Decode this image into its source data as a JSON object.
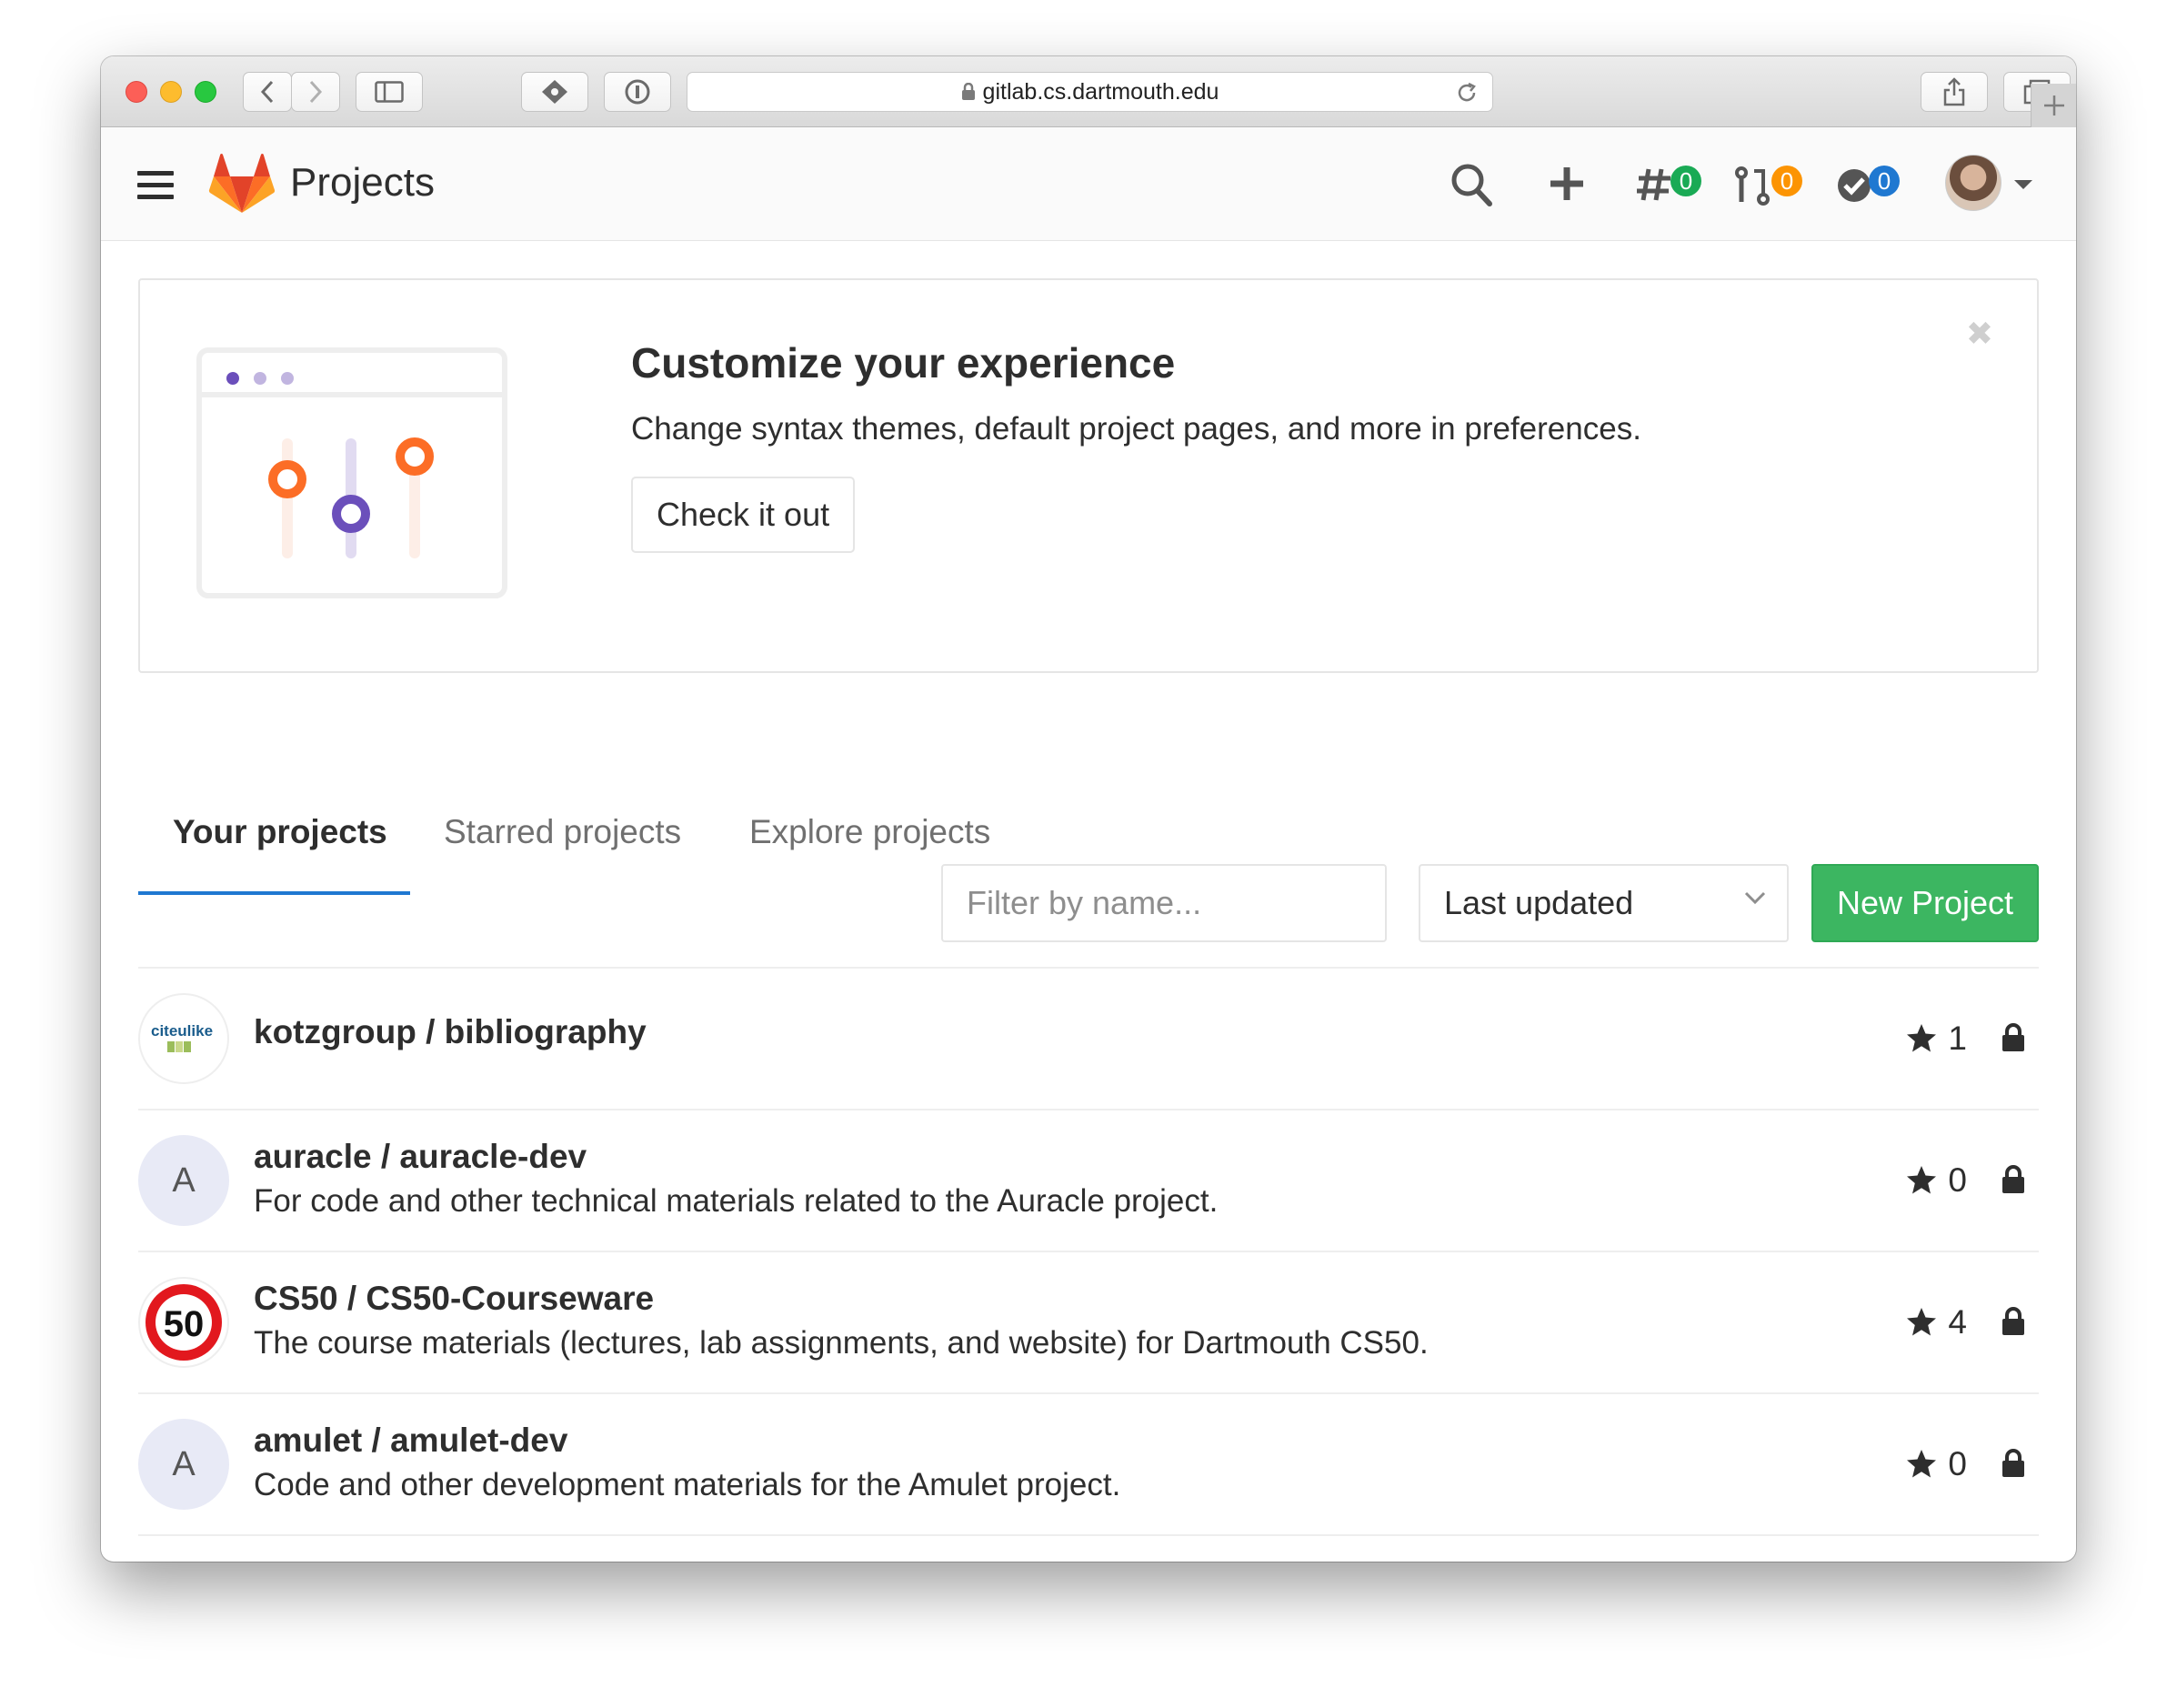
{
  "browser": {
    "url": "gitlab.cs.dartmouth.edu"
  },
  "header": {
    "title": "Projects",
    "issues_count": "0",
    "merge_requests_count": "0",
    "todos_count": "0",
    "colors": {
      "issues_badge": "#1aaa55",
      "mr_badge": "#fc9403",
      "todos_badge": "#1f78d1"
    }
  },
  "callout": {
    "title": "Customize your experience",
    "text": "Change syntax themes, default project pages, and more in preferences.",
    "button": "Check it out"
  },
  "tabs": [
    {
      "label": "Your projects",
      "active": true
    },
    {
      "label": "Starred projects",
      "active": false
    },
    {
      "label": "Explore projects",
      "active": false
    }
  ],
  "filters": {
    "search_placeholder": "Filter by name...",
    "sort_value": "Last updated",
    "new_project_label": "New Project"
  },
  "projects": [
    {
      "name": "kotzgroup / bibliography",
      "description": "",
      "stars": "1",
      "avatar": "citeulike"
    },
    {
      "name": "auracle / auracle-dev",
      "description": "For code and other technical materials related to the Auracle project.",
      "stars": "0",
      "avatar": "A"
    },
    {
      "name": "CS50 / CS50-Courseware",
      "description": "The course materials (lectures, lab assignments, and website) for Dartmouth CS50.",
      "stars": "4",
      "avatar": "50"
    },
    {
      "name": "amulet / amulet-dev",
      "description": "Code and other development materials for the Amulet project.",
      "stars": "0",
      "avatar": "A"
    }
  ]
}
